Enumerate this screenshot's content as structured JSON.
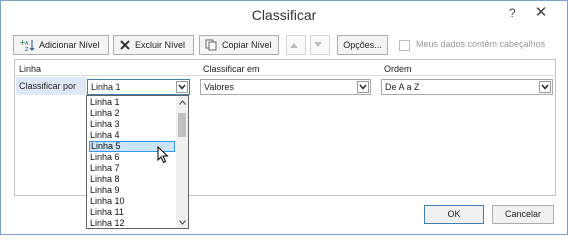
{
  "dialog": {
    "title": "Classificar",
    "help_glyph": "?",
    "close_glyph": "✕"
  },
  "toolbar": {
    "add_level": "Adicionar Nível",
    "delete_level": "Excluir Nível",
    "copy_level": "Copiar Nível",
    "options": "Opções...",
    "has_headers_label": "Meus dados contêm cabeçalhos",
    "has_headers_checked": false
  },
  "grid": {
    "headers": {
      "column": "Linha",
      "sort_on": "Classificar em",
      "order": "Ordem"
    },
    "row": {
      "label": "Classificar por",
      "column_value": "Linha 1",
      "sort_on_value": "Valores",
      "order_value": "De A a Z"
    }
  },
  "dropdown": {
    "options": [
      "Linha 1",
      "Linha 2",
      "Linha 3",
      "Linha 4",
      "Linha 5",
      "Linha 6",
      "Linha 7",
      "Linha 8",
      "Linha 9",
      "Linha 10",
      "Linha 11",
      "Linha 12"
    ],
    "highlighted_index": 4
  },
  "footer": {
    "ok": "OK",
    "cancel": "Cancelar"
  },
  "colors": {
    "accent_border": "#3c7fb1",
    "highlight_fill": "#cce4f7",
    "row_selection": "#dfe8f6"
  }
}
